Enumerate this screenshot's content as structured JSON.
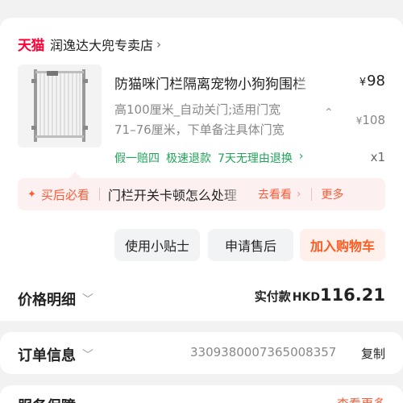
{
  "store": {
    "brand": "天猫",
    "name": "润逸达大兜专卖店"
  },
  "product": {
    "title": "防猫咪门栏隔离宠物小狗狗围栏",
    "price": "98",
    "spec_line1": "高100厘米_自动关门;适用门宽",
    "spec_line2": "71–76厘米，下单备注具体门宽",
    "original_price": "108",
    "currency_symbol": "¥",
    "guarantees": [
      "假一赔四",
      "极速退款",
      "7天无理由退换"
    ],
    "quantity": "x1"
  },
  "tip": {
    "title": "买后必看",
    "text": "门栏开关卡顿怎么处理",
    "link": "去看看",
    "more": "更多"
  },
  "actions": {
    "tips": "使用小贴士",
    "aftersale": "申请售后",
    "cart": "加入购物车"
  },
  "price_detail": {
    "label": "价格明细",
    "paid_label": "实付款",
    "currency": "HKD",
    "amount": "116.21"
  },
  "order_info": {
    "label": "订单信息",
    "order_number": "3309380007365008357",
    "copy": "复制"
  },
  "service": {
    "label": "服务保障",
    "more": "查看更多"
  },
  "colors": {
    "tmall_red": "#ff0036",
    "accent_orange": "#ff5a36",
    "guarantee_green": "#21a35a",
    "tip_background": "#fdf0f0"
  }
}
